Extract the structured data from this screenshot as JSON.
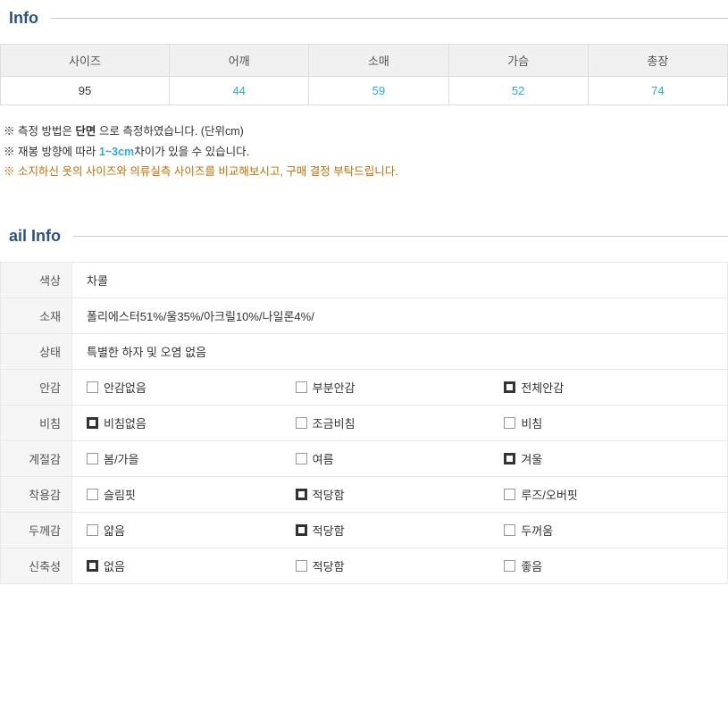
{
  "info_section": {
    "title": "Info"
  },
  "size_table": {
    "headers": [
      "사이즈",
      "어깨",
      "소매",
      "가슴",
      "총장"
    ],
    "rows": [
      [
        "95",
        "44",
        "59",
        "52",
        "74"
      ]
    ]
  },
  "size_notes": [
    "※ 측정 방법은 단면 으로 측정하였습니다. (단위cm)",
    "※ 재봉 방향에 따라 1~3cm차이가 있을 수 있습니다.",
    "※ 소지하신 옷의 사이즈와 의류실측 사이즈를 비교해보시고, 구매 결정 부탁드립니다."
  ],
  "detail_section": {
    "title": "ail Info"
  },
  "detail_rows": [
    {
      "label": "색상",
      "type": "text",
      "value": "차콜"
    },
    {
      "label": "소재",
      "type": "text",
      "value": "폴리에스터51%/울35%/아크릴10%/나일론4%/"
    },
    {
      "label": "상태",
      "type": "text",
      "value": "특별한 하자 및 오염 없음"
    },
    {
      "label": "안감",
      "type": "checkbox",
      "items": [
        {
          "label": "안감없음",
          "checked": false
        },
        {
          "label": "부분안감",
          "checked": false
        },
        {
          "label": "전체안감",
          "checked": true
        }
      ]
    },
    {
      "label": "비침",
      "type": "checkbox",
      "items": [
        {
          "label": "비침없음",
          "checked": true
        },
        {
          "label": "조금비침",
          "checked": false
        },
        {
          "label": "비침",
          "checked": false
        }
      ]
    },
    {
      "label": "계절감",
      "type": "checkbox",
      "items": [
        {
          "label": "봄/가을",
          "checked": false
        },
        {
          "label": "여름",
          "checked": false
        },
        {
          "label": "겨울",
          "checked": true
        }
      ]
    },
    {
      "label": "착용감",
      "type": "checkbox",
      "items": [
        {
          "label": "슬림핏",
          "checked": false
        },
        {
          "label": "적당함",
          "checked": true
        },
        {
          "label": "루즈/오버핏",
          "checked": false
        }
      ]
    },
    {
      "label": "두께감",
      "type": "checkbox",
      "items": [
        {
          "label": "얇음",
          "checked": false
        },
        {
          "label": "적당함",
          "checked": true
        },
        {
          "label": "두꺼움",
          "checked": false
        }
      ]
    },
    {
      "label": "신축성",
      "type": "checkbox",
      "items": [
        {
          "label": "없음",
          "checked": true
        },
        {
          "label": "적당함",
          "checked": false
        },
        {
          "label": "좋음",
          "checked": false
        }
      ]
    }
  ]
}
